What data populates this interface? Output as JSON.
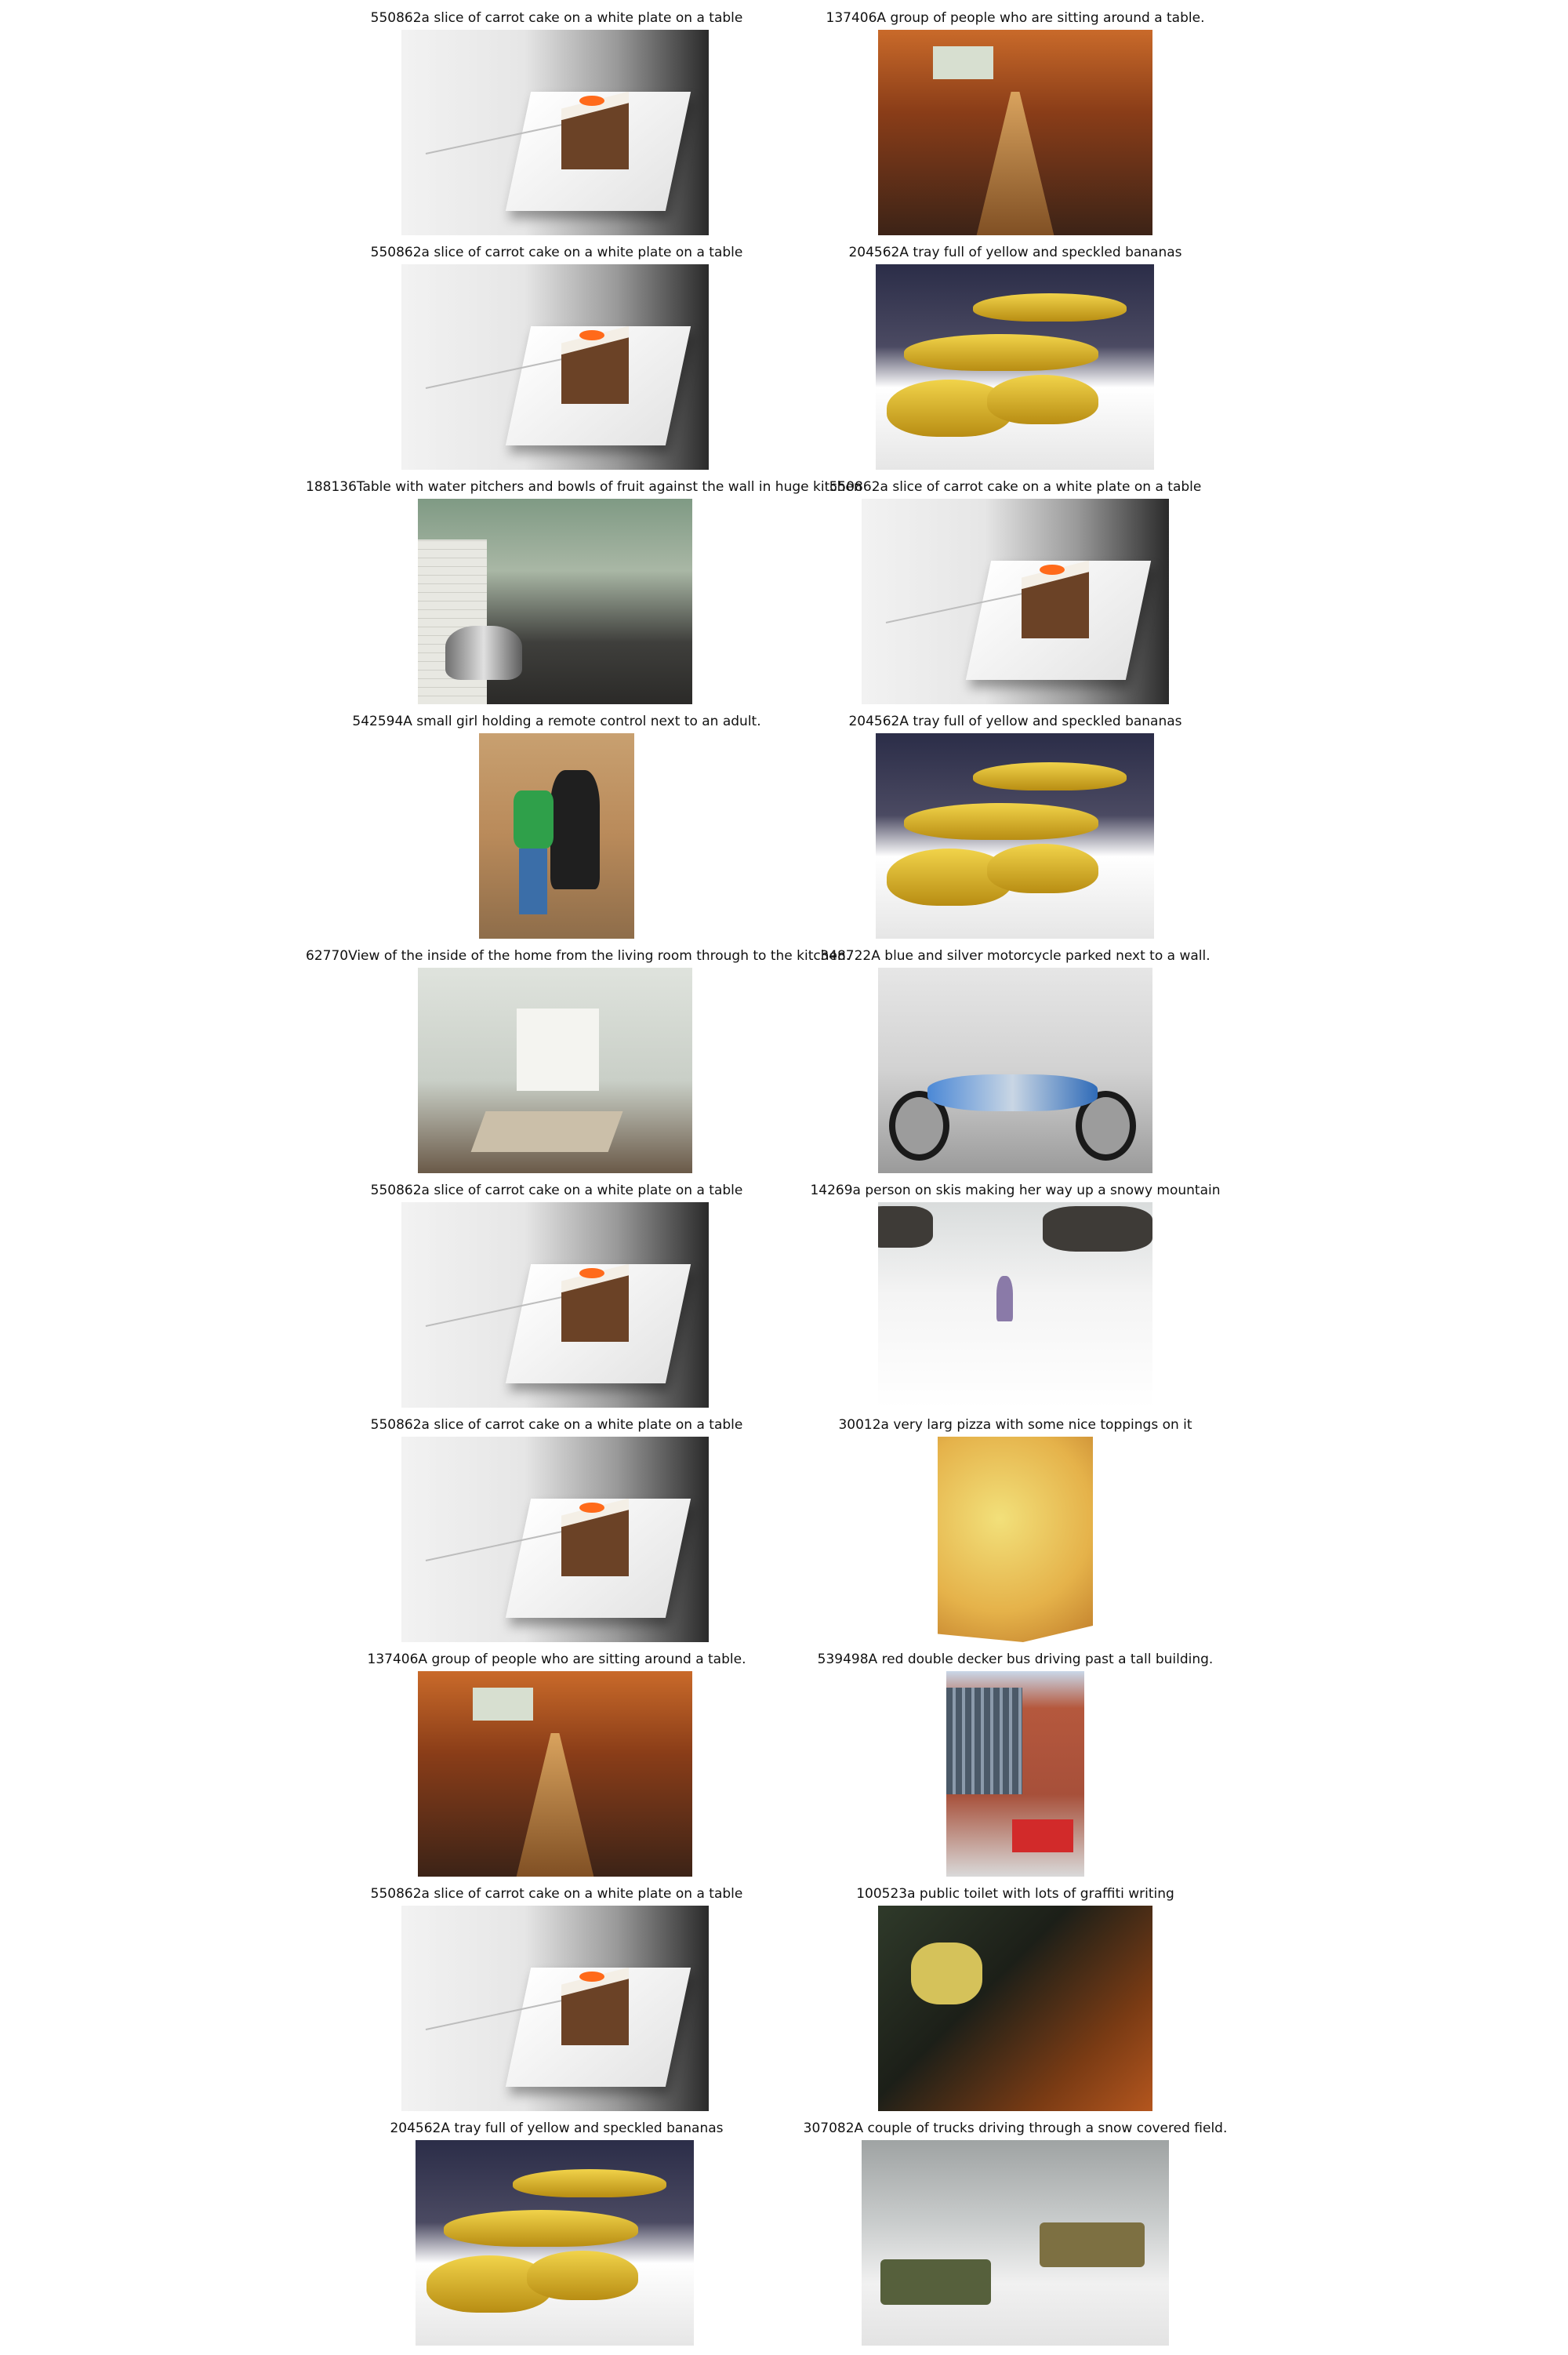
{
  "images": [
    {
      "caption": "550862a slice of carrot cake on a white plate on a table",
      "scene": "cake"
    },
    {
      "caption": "137406A group of people who are sitting around a table.",
      "scene": "people"
    },
    {
      "caption": "550862a slice of carrot cake on a white plate on a table",
      "scene": "cake"
    },
    {
      "caption": "204562A tray full of yellow and speckled bananas",
      "scene": "bananas"
    },
    {
      "caption": "188136Table with water pitchers and bowls of fruit against the wall in huge kitchen",
      "scene": "kitchen"
    },
    {
      "caption": "550862a slice of carrot cake on a white plate on a table",
      "scene": "cake"
    },
    {
      "caption": "542594A small girl holding a remote control next to an adult.",
      "scene": "girl"
    },
    {
      "caption": "204562A tray full of yellow and speckled bananas",
      "scene": "bananas"
    },
    {
      "caption": "62770View of the inside of the home from the living room through to the kitchen.",
      "scene": "home"
    },
    {
      "caption": "348722A blue and silver motorcycle parked next to a wall.",
      "scene": "motorcycle"
    },
    {
      "caption": "550862a slice of carrot cake on a white plate on a table",
      "scene": "cake"
    },
    {
      "caption": "14269a person on skis making her way up a snowy mountain",
      "scene": "skier"
    },
    {
      "caption": "550862a slice of carrot cake on a white plate on a table",
      "scene": "cake"
    },
    {
      "caption": "30012a very larg pizza with some nice toppings on it",
      "scene": "pizza"
    },
    {
      "caption": "137406A group of people who are sitting around a table.",
      "scene": "people"
    },
    {
      "caption": "539498A red double decker bus driving past a tall building.",
      "scene": "bus"
    },
    {
      "caption": "550862a slice of carrot cake on a white plate on a table",
      "scene": "cake"
    },
    {
      "caption": "100523a public toilet with lots of graffiti writing",
      "scene": "toilet"
    },
    {
      "caption": "204562A tray full of yellow and speckled bananas",
      "scene": "bananas"
    },
    {
      "caption": "307082A couple of trucks driving through a snow covered field.",
      "scene": "trucks"
    }
  ]
}
